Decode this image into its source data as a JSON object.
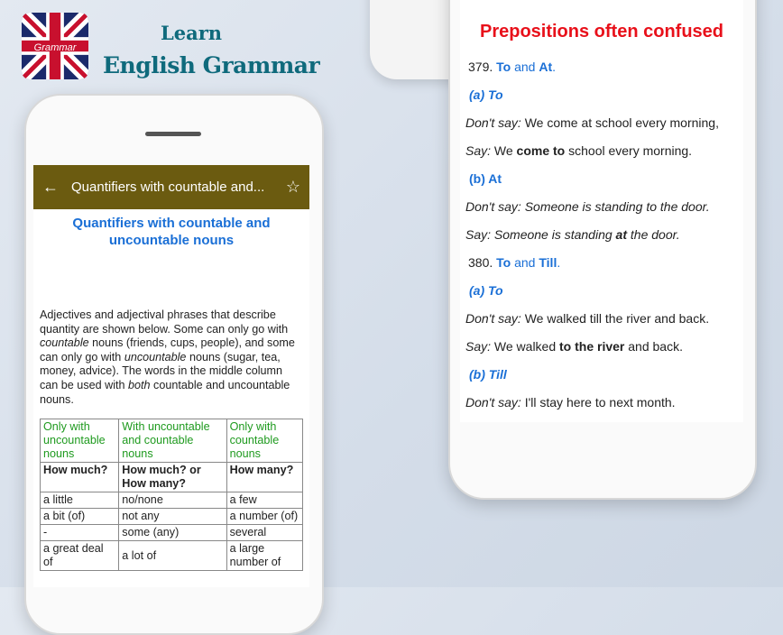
{
  "brand": {
    "logo_text": "Grammar",
    "logo_small": "LEARN",
    "line1": "Learn",
    "line2": "English Grammar"
  },
  "left_screen": {
    "appbar": {
      "title": "Quantifiers with countable and...",
      "back_icon": "arrow-left-icon",
      "star_icon": "star-outline-icon"
    },
    "title": "Quantifiers with countable and uncountable nouns",
    "paragraph": [
      {
        "t": "Adjectives and adjectival phrases that describe quantity are shown below. Some can only go with ",
        "i": false
      },
      {
        "t": "countable",
        "i": true
      },
      {
        "t": " nouns (friends, cups, people), and some can only go with ",
        "i": false
      },
      {
        "t": "uncountable",
        "i": true
      },
      {
        "t": " nouns (sugar, tea, money, advice). The words in the middle column can be used with ",
        "i": false
      },
      {
        "t": "both",
        "i": true
      },
      {
        "t": " countable and uncountable nouns.",
        "i": false
      }
    ],
    "table": {
      "headers": [
        "Only with uncountable nouns",
        "With uncountable and countable nouns",
        "Only with countable nouns"
      ],
      "questions": [
        "How much?",
        "How much? or How many?",
        "How many?"
      ],
      "rows": [
        [
          "a little",
          "no/none",
          "a few"
        ],
        [
          "a bit (of)",
          "not any",
          "a number (of)"
        ],
        [
          "-",
          "some (any)",
          "several"
        ],
        [
          "a great deal of",
          "a lot of",
          "a large number of"
        ]
      ]
    }
  },
  "right_screen": {
    "title": "Prepositions often confused",
    "lines": [
      [
        {
          "t": "379. "
        },
        {
          "t": "To",
          "c": "b"
        },
        {
          "t": " and ",
          "c": "b0"
        },
        {
          "t": "At",
          "c": "b"
        },
        {
          "t": ".",
          "c": "b0"
        }
      ],
      [
        {
          "t": "(a) To",
          "c": "bi"
        }
      ],
      [
        {
          "t": "Don't say:",
          "s": "i"
        },
        {
          "t": " We come at school every morning,"
        }
      ],
      [
        {
          "t": "Say:",
          "s": "i"
        },
        {
          "t": " We "
        },
        {
          "t": "come to",
          "s": "b"
        },
        {
          "t": " school  every morning."
        }
      ],
      [
        {
          "t": "(b) At",
          "c": "b"
        }
      ],
      [
        {
          "t": "Don't say: Someone is standing to the door.",
          "s": "i"
        }
      ],
      [
        {
          "t": "Say: Someone is standing ",
          "s": "i"
        },
        {
          "t": "at",
          "s": "bi"
        },
        {
          "t": " the door.",
          "s": "i"
        }
      ],
      [
        {
          "t": "380. "
        },
        {
          "t": "To",
          "c": "b"
        },
        {
          "t": " and ",
          "c": "b0"
        },
        {
          "t": "Till",
          "c": "b"
        },
        {
          "t": ".",
          "c": "b0"
        }
      ],
      [
        {
          "t": "(a) To",
          "c": "bi"
        }
      ],
      [
        {
          "t": "Don't say:",
          "s": "i"
        },
        {
          "t": " We walked till the river and back."
        }
      ],
      [
        {
          "t": "Say:",
          "s": "i"
        },
        {
          "t": " We walked "
        },
        {
          "t": "to the river",
          "s": "b"
        },
        {
          "t": " and  back."
        }
      ],
      [
        {
          "t": "(b) Till",
          "c": "bi"
        }
      ],
      [
        {
          "t": "Don't say:",
          "s": "i"
        },
        {
          "t": " I'll stay here to next month."
        }
      ]
    ]
  },
  "colors": {
    "appbar": "#6b5b10",
    "title_blue": "#1a6fd6",
    "title_red": "#e8101a",
    "header_green": "#1e9a1e",
    "brand_teal": "#0f6a7c"
  }
}
